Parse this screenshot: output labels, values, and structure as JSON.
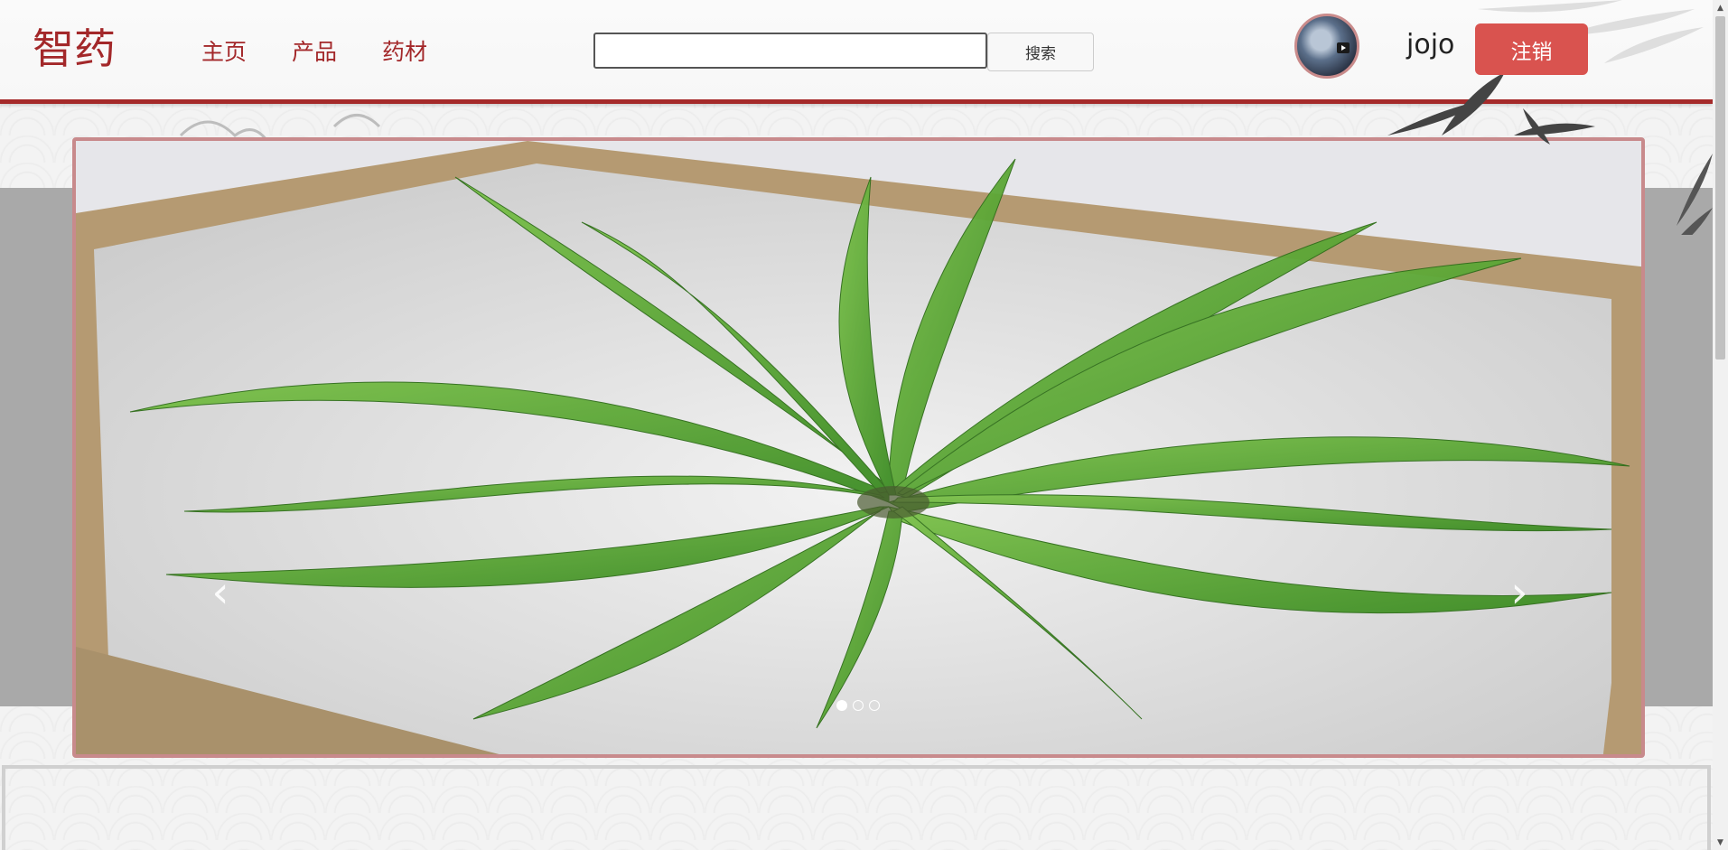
{
  "header": {
    "logo": "智药",
    "nav": [
      "主页",
      "产品",
      "药材"
    ],
    "search": {
      "value": "",
      "placeholder": "",
      "button_label": "搜索"
    },
    "user": {
      "name": "jojo",
      "logout_label": "注销"
    }
  },
  "carousel": {
    "slide_count": 3,
    "active_index": 0,
    "prev_icon": "chevron-left-icon",
    "next_icon": "chevron-right-icon",
    "image_subject": "green grass plant on white gravel in wooden frame"
  },
  "colors": {
    "brand": "#a3282a",
    "header_border": "#a52a2a",
    "logout_button": "#d9534f",
    "carousel_border": "#c88a8c"
  }
}
